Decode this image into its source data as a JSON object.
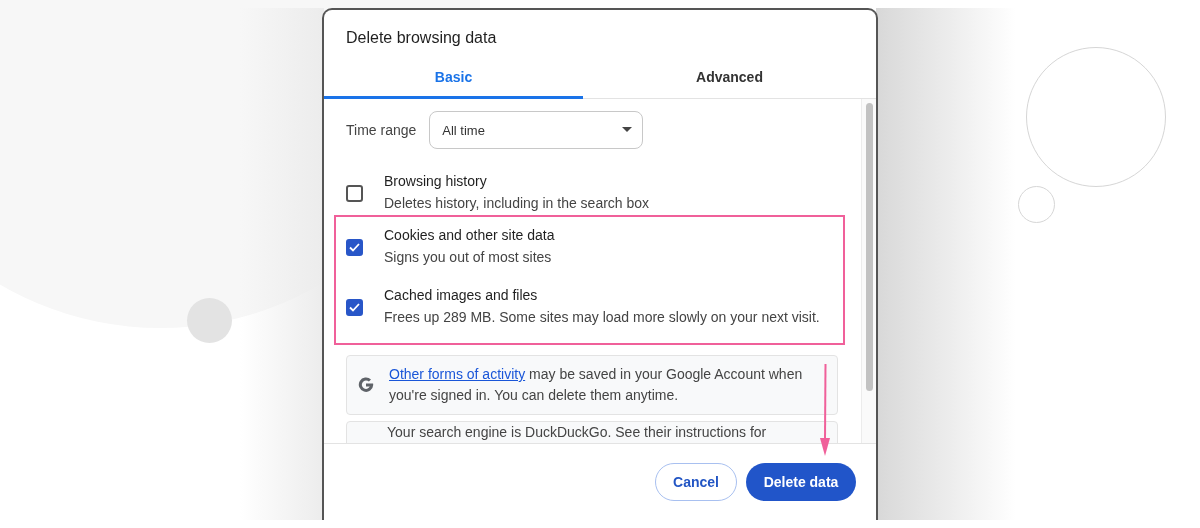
{
  "dialog": {
    "title": "Delete browsing data"
  },
  "tabs": [
    {
      "label": "Basic",
      "selected": true
    },
    {
      "label": "Advanced",
      "selected": false
    }
  ],
  "time_range": {
    "label": "Time range",
    "value": "All time"
  },
  "items": [
    {
      "title": "Browsing history",
      "description": "Deletes history, including in the search box",
      "checked": false,
      "highlighted": false
    },
    {
      "title": "Cookies and other site data",
      "description": "Signs you out of most sites",
      "checked": true,
      "highlighted": true
    },
    {
      "title": "Cached images and files",
      "description": "Frees up 289 MB. Some sites may load more slowly on your next visit.",
      "checked": true,
      "highlighted": true
    }
  ],
  "notices": [
    {
      "kind": "google",
      "link": "Other forms of activity",
      "text": " may be saved in your Google Account when you're signed in. You can delete them anytime."
    },
    {
      "kind": "plain",
      "text": "Your search engine is DuckDuckGo. See their instructions for"
    }
  ],
  "buttons": [
    {
      "label": "Cancel",
      "kind": "secondary"
    },
    {
      "label": "Delete data",
      "kind": "primary"
    }
  ],
  "annotation": {
    "arrow": true
  }
}
